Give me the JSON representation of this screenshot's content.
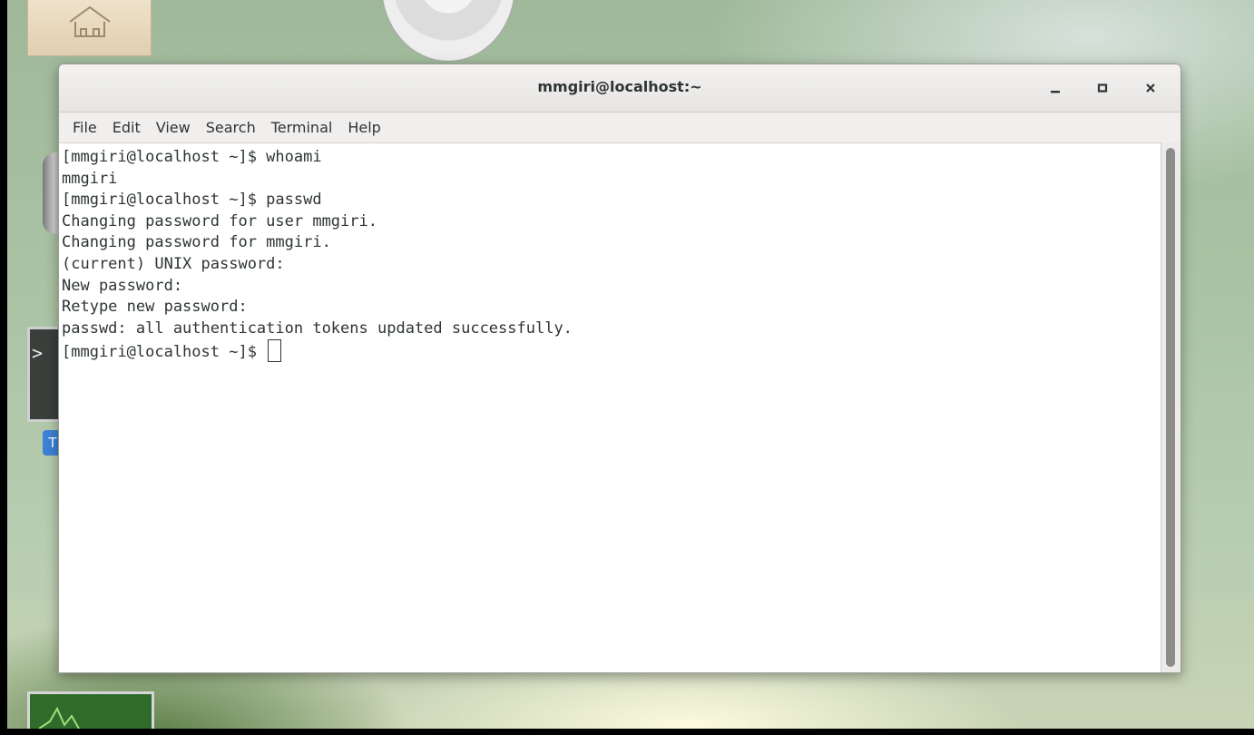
{
  "window": {
    "title": "mmgiri@localhost:~",
    "controls": {
      "minimize_icon": "minimize-icon",
      "maximize_icon": "maximize-icon",
      "close_icon": "close-icon"
    }
  },
  "menu": {
    "items": [
      "File",
      "Edit",
      "View",
      "Search",
      "Terminal",
      "Help"
    ]
  },
  "terminal": {
    "lines": [
      "[mmgiri@localhost ~]$ whoami",
      "mmgiri",
      "[mmgiri@localhost ~]$ passwd",
      "Changing password for user mmgiri.",
      "Changing password for mmgiri.",
      "(current) UNIX password:",
      "New password:",
      "Retype new password:",
      "passwd: all authentication tokens updated successfully."
    ],
    "prompt": "[mmgiri@localhost ~]$ "
  },
  "desktop": {
    "icons": [
      "home-icon",
      "disc-icon",
      "trash-icon",
      "terminal-icon",
      "system-monitor-icon"
    ],
    "terminal_icon_glyph": ">",
    "terminal_badge_letter": "T"
  },
  "colors": {
    "terminal_bg": "#ffffff",
    "terminal_fg": "#2e3436",
    "titlebar_bg": "#f0efed",
    "badge_blue": "#3d82d6"
  }
}
